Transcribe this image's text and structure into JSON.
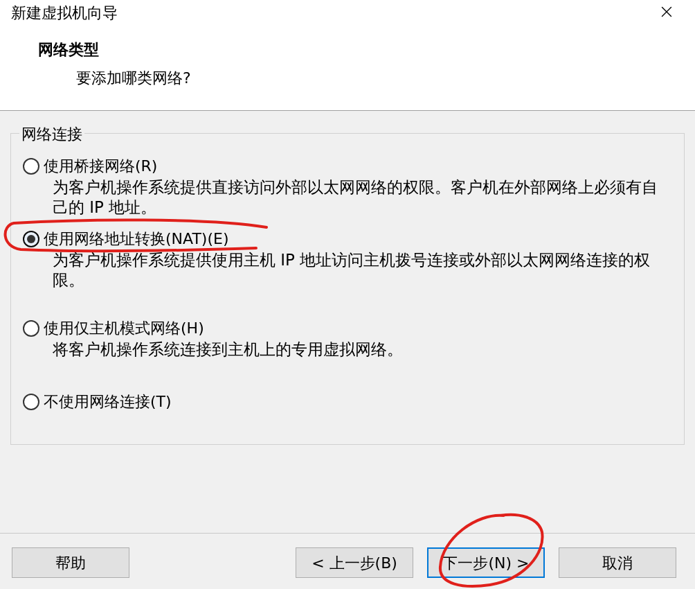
{
  "window": {
    "title": "新建虚拟机向导"
  },
  "header": {
    "title": "网络类型",
    "subtitle": "要添加哪类网络?"
  },
  "group": {
    "legend": "网络连接"
  },
  "options": [
    {
      "label": "使用桥接网络(R)",
      "description": "为客户机操作系统提供直接访问外部以太网网络的权限。客户机在外部网络上必须有自己的 IP 地址。",
      "selected": false
    },
    {
      "label": "使用网络地址转换(NAT)(E)",
      "description": "为客户机操作系统提供使用主机 IP 地址访问主机拨号连接或外部以太网网络连接的权限。",
      "selected": true
    },
    {
      "label": "使用仅主机模式网络(H)",
      "description": "将客户机操作系统连接到主机上的专用虚拟网络。",
      "selected": false
    },
    {
      "label": "不使用网络连接(T)",
      "selected": false
    }
  ],
  "buttons": [
    {
      "label": "帮助",
      "focused": false
    },
    {
      "label": "< 上一步(B)",
      "focused": false
    },
    {
      "label": "下一步(N) >",
      "focused": true
    },
    {
      "label": "取消",
      "focused": false
    }
  ]
}
